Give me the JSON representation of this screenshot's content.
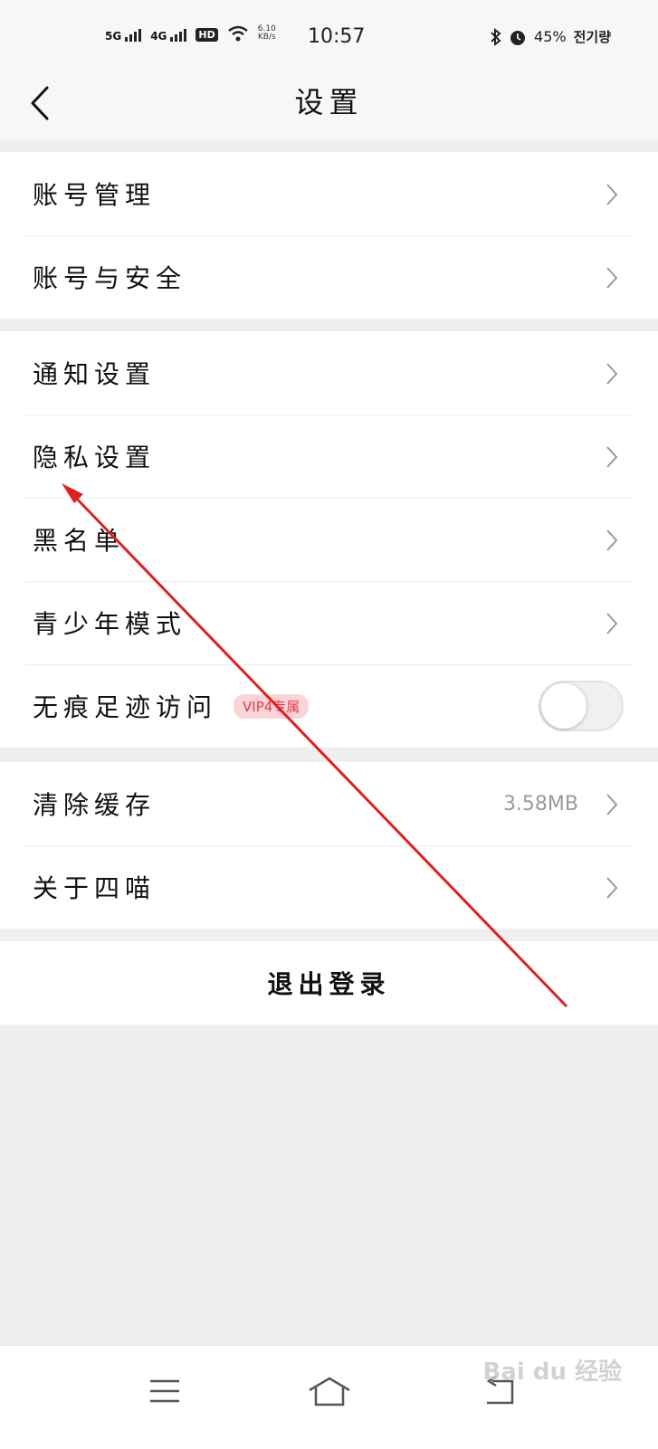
{
  "status_bar": {
    "signal1": "5G",
    "signal2": "4G",
    "hd_badge": "HD",
    "network_speed_value": "6.10",
    "network_speed_unit": "KB/s",
    "time": "10:57",
    "battery": "45%",
    "carrier": "전기량"
  },
  "header": {
    "title": "设置"
  },
  "groups": {
    "account": {
      "items": [
        {
          "label": "账号管理"
        },
        {
          "label": "账号与安全"
        }
      ]
    },
    "settings": {
      "items": [
        {
          "label": "通知设置"
        },
        {
          "label": "隐私设置"
        },
        {
          "label": "黑名单"
        },
        {
          "label": "青少年模式"
        },
        {
          "label": "无痕足迹访问",
          "badge": "VIP4专属",
          "toggle_on": false
        }
      ]
    },
    "misc": {
      "items": [
        {
          "label": "清除缓存",
          "value": "3.58MB"
        },
        {
          "label": "关于四喵"
        }
      ]
    }
  },
  "logout": {
    "label": "退出登录"
  },
  "watermark": "Bai du 经验",
  "colors": {
    "vip_text": "#e5384a",
    "vip_bg": "#fbd4d8",
    "annotation_arrow": "#e02020"
  }
}
